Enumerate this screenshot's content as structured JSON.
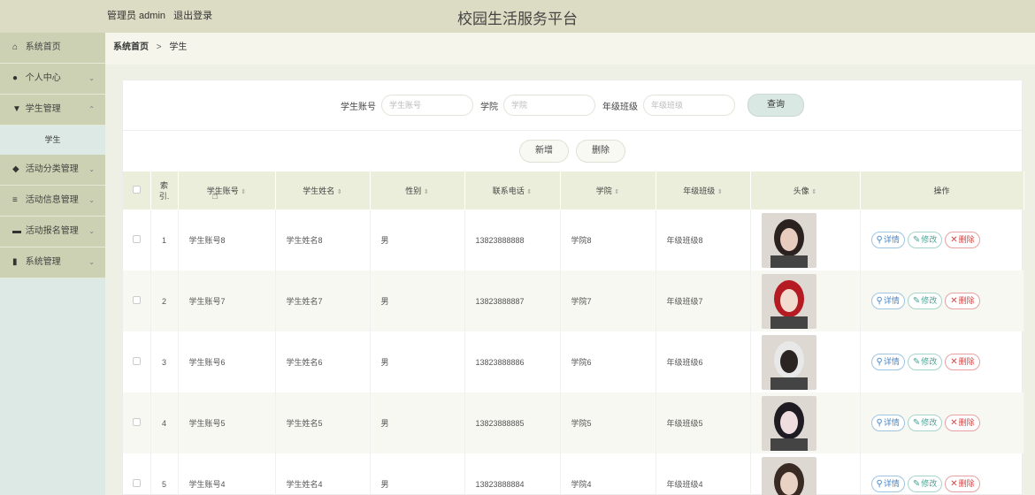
{
  "header": {
    "user_text": "管理员 admin",
    "logout": "退出登录",
    "title": "校园生活服务平台"
  },
  "sidebar": {
    "items": [
      {
        "label": "系统首页",
        "icon": "home-icon",
        "glyph": "⌂",
        "arrow": ""
      },
      {
        "label": "个人中心",
        "icon": "user-icon",
        "glyph": "●",
        "arrow": "⌄"
      },
      {
        "label": "学生管理",
        "icon": "shield-icon",
        "glyph": "▼",
        "arrow": "⌃"
      },
      {
        "label": "活动分类管理",
        "icon": "location-icon",
        "glyph": "◆",
        "arrow": "⌄"
      },
      {
        "label": "活动信息管理",
        "icon": "sliders-icon",
        "glyph": "≡",
        "arrow": "⌄"
      },
      {
        "label": "活动报名管理",
        "icon": "briefcase-icon",
        "glyph": "▬",
        "arrow": "⌄"
      },
      {
        "label": "系统管理",
        "icon": "bar-chart-icon",
        "glyph": "▮",
        "arrow": "⌄"
      }
    ],
    "sub_item": "学生"
  },
  "breadcrumb": {
    "home": "系统首页",
    "sep": ">",
    "current": "学生"
  },
  "search": {
    "account_label": "学生账号",
    "account_placeholder": "学生账号",
    "college_label": "学院",
    "college_placeholder": "学院",
    "class_label": "年级班级",
    "class_placeholder": "年级班级",
    "query_button": "查询"
  },
  "actions": {
    "add": "新增",
    "delete": "删除"
  },
  "table": {
    "headers": {
      "index": "索\n引.",
      "account": "学生账号",
      "name": "学生姓名",
      "gender": "性别",
      "phone": "联系电话",
      "college": "学院",
      "class": "年级班级",
      "avatar": "头像",
      "ops": "操作"
    },
    "sort_mark": "⇕",
    "rows": [
      {
        "idx": "1",
        "account": "学生账号8",
        "name": "学生姓名8",
        "gender": "男",
        "phone": "13823888888",
        "college": "学院8",
        "class": "年级班级8"
      },
      {
        "idx": "2",
        "account": "学生账号7",
        "name": "学生姓名7",
        "gender": "男",
        "phone": "13823888887",
        "college": "学院7",
        "class": "年级班级7"
      },
      {
        "idx": "3",
        "account": "学生账号6",
        "name": "学生姓名6",
        "gender": "男",
        "phone": "13823888886",
        "college": "学院6",
        "class": "年级班级6"
      },
      {
        "idx": "4",
        "account": "学生账号5",
        "name": "学生姓名5",
        "gender": "男",
        "phone": "13823888885",
        "college": "学院5",
        "class": "年级班级5"
      },
      {
        "idx": "5",
        "account": "学生账号4",
        "name": "学生姓名4",
        "gender": "男",
        "phone": "13823888884",
        "college": "学院4",
        "class": "年级班级4"
      }
    ],
    "ops": {
      "detail": "详情",
      "edit": "修改",
      "delete": "删除"
    }
  }
}
